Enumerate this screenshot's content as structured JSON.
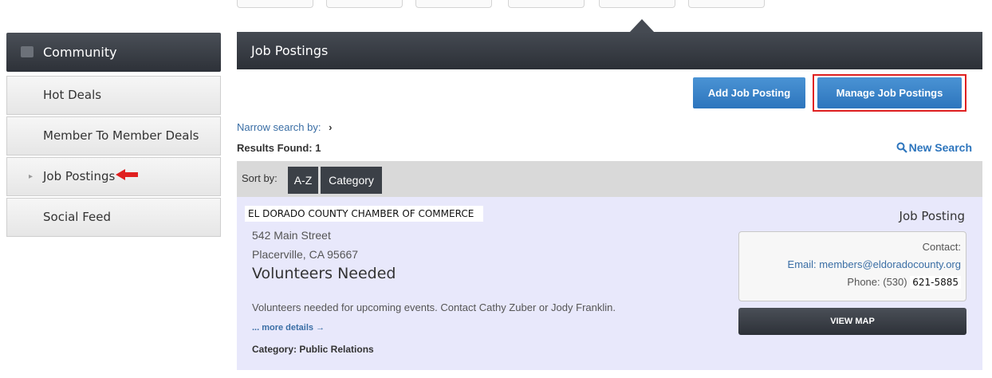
{
  "sidebar": {
    "header": "Community",
    "items": [
      {
        "label": "Hot Deals"
      },
      {
        "label": "Member To Member Deals"
      },
      {
        "label": "Job Postings"
      },
      {
        "label": "Social Feed"
      }
    ]
  },
  "main": {
    "title": "Job Postings",
    "add_button": "Add Job Posting",
    "manage_button": "Manage Job Postings",
    "narrow_label": "Narrow search by:",
    "narrow_chevron": "›",
    "results_label": "Results Found: 1",
    "new_search": "New Search",
    "sort": {
      "label": "Sort by:",
      "options": [
        "A-Z",
        "Category"
      ]
    }
  },
  "listing": {
    "org": "EL DORADO COUNTY CHAMBER OF COMMERCE",
    "address1": "542 Main Street",
    "address2": "Placerville, CA 95667",
    "title": "Volunteers Needed",
    "description": "Volunteers needed for upcoming events. Contact Cathy Zuber or Jody Franklin.",
    "more_details": "... more details →",
    "category": "Category: Public Relations",
    "type_label": "Job Posting",
    "contact_label": "Contact:",
    "email": "Email: members@eldoradocounty.org",
    "phone_prefix": "Phone: (530)",
    "phone_number": "621-5885",
    "view_map": "VIEW MAP"
  },
  "colors": {
    "accent_blue": "#2d75bd",
    "dark_bar": "#2c3037",
    "highlight_red": "#e02020",
    "listing_bg": "#e8e8fb"
  }
}
